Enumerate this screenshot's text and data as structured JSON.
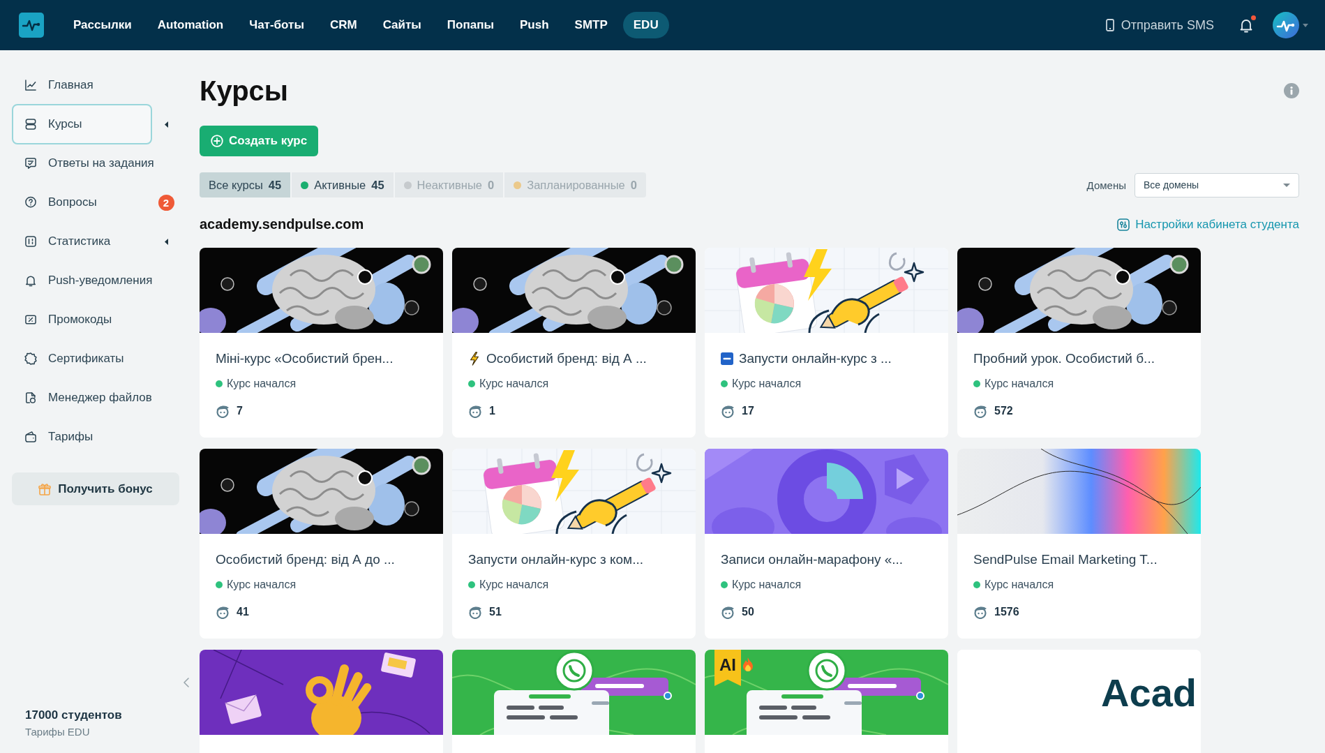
{
  "header": {
    "nav": [
      {
        "label": "Рассылки",
        "selected": false
      },
      {
        "label": "Automation",
        "selected": false
      },
      {
        "label": "Чат-боты",
        "selected": false
      },
      {
        "label": "CRM",
        "selected": false
      },
      {
        "label": "Сайты",
        "selected": false
      },
      {
        "label": "Попапы",
        "selected": false
      },
      {
        "label": "Push",
        "selected": false
      },
      {
        "label": "SMTP",
        "selected": false
      },
      {
        "label": "EDU",
        "selected": true
      }
    ],
    "sms_button": "Отправить SMS",
    "notifications": {
      "unread": true
    }
  },
  "sidebar": {
    "items": [
      {
        "label": "Главная",
        "selected": false,
        "submenu": false
      },
      {
        "label": "Курсы",
        "selected": true,
        "submenu": true
      },
      {
        "label": "Ответы на задания",
        "selected": false,
        "submenu": false
      },
      {
        "label": "Вопросы",
        "selected": false,
        "submenu": false,
        "badge": "2"
      },
      {
        "label": "Статистика",
        "selected": false,
        "submenu": true
      },
      {
        "label": "Push-уведомления",
        "selected": false,
        "submenu": false
      },
      {
        "label": "Промокоды",
        "selected": false,
        "submenu": false
      },
      {
        "label": "Сертификаты",
        "selected": false,
        "submenu": false
      },
      {
        "label": "Менеджер файлов",
        "selected": false,
        "submenu": false
      },
      {
        "label": "Тарифы",
        "selected": false,
        "submenu": false
      }
    ],
    "bonus_button": "Получить бонус",
    "footer": {
      "students": "17000 студентов",
      "plan_link": "Тарифы EDU"
    }
  },
  "page": {
    "title": "Курсы",
    "create_button": "Создать курс",
    "filters": [
      {
        "label": "Все курсы",
        "count": "45",
        "selected": true,
        "disabled": false
      },
      {
        "label": "Активные",
        "count": "45",
        "selected": false,
        "disabled": false,
        "color": "#1aae6f"
      },
      {
        "label": "Неактивные",
        "count": "0",
        "selected": false,
        "disabled": true,
        "color": "#c6cacd"
      },
      {
        "label": "Запланированные",
        "count": "0",
        "selected": false,
        "disabled": true,
        "color": "#ebc98b"
      }
    ],
    "domain_filter": {
      "label": "Домены",
      "value": "Все домены"
    },
    "domain": "academy.sendpulse.com",
    "settings_link": "Настройки кабинета студента",
    "courses": [
      {
        "kind": "brain",
        "title": "Міні-курс «Особистий брен...",
        "status": "Курс начался",
        "students": "7"
      },
      {
        "kind": "brain",
        "title": "Особистий бренд: від А ...",
        "status": "Курс начался",
        "students": "1"
      },
      {
        "kind": "calendar",
        "title": "Запусти онлайн-курс з ...",
        "status": "Курс начался",
        "students": "17"
      },
      {
        "kind": "brain",
        "title": "Пробний урок. Особистий б...",
        "status": "Курс начался",
        "students": "572"
      },
      {
        "kind": "brain",
        "title": "Особистий бренд: від А до ...",
        "status": "Курс начался",
        "students": "41"
      },
      {
        "kind": "calendar",
        "title": "Запусти онлайн-курс з ком...",
        "status": "Курс начался",
        "students": "51"
      },
      {
        "kind": "shapes",
        "title": "Записи онлайн-марафону «...",
        "status": "Курс начался",
        "students": "50"
      },
      {
        "kind": "gradient",
        "title": "SendPulse Email Marketing T...",
        "status": "Курс начался",
        "students": "1576"
      },
      {
        "kind": "hand"
      },
      {
        "kind": "chat"
      },
      {
        "kind": "chat",
        "cover_label": "AI"
      },
      {
        "kind": "logo",
        "cover_label": "Acad"
      }
    ]
  }
}
